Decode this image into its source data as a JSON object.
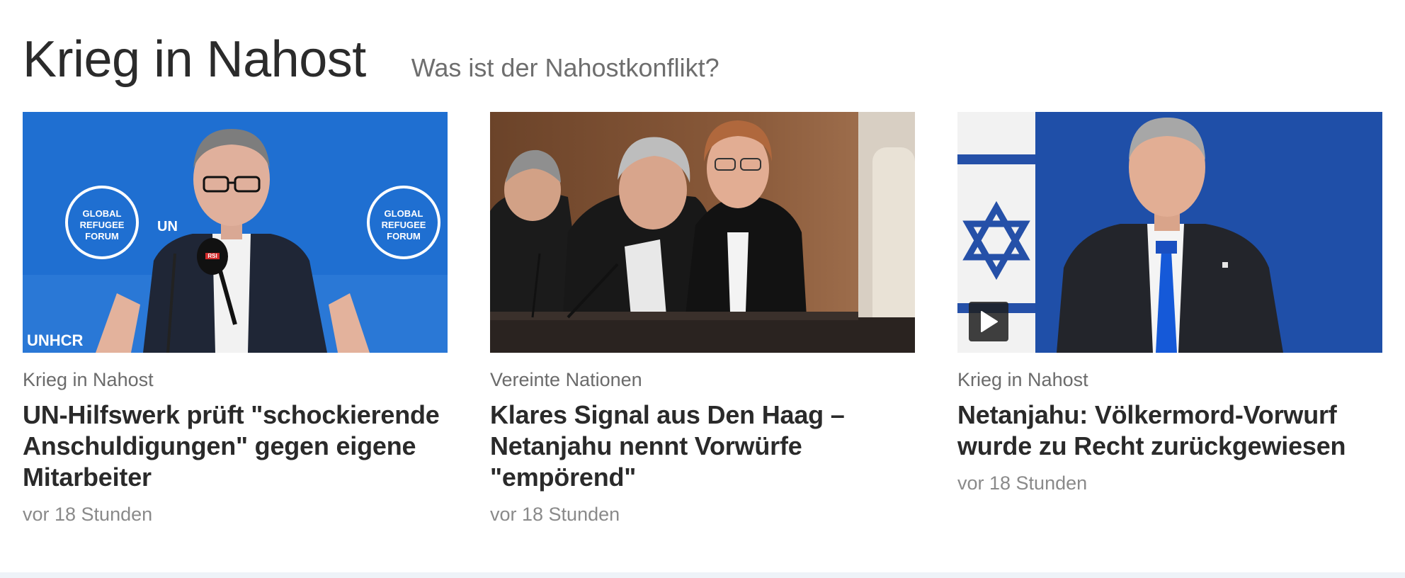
{
  "section": {
    "title": "Krieg in Nahost",
    "link": "Was ist der Nahostkonflikt?"
  },
  "cards": [
    {
      "topline": "Krieg in Nahost",
      "headline": "UN-Hilfswerk prüft \"schockierende Anschuldigungen\" gegen eigene Mitarbeiter",
      "date": "vor 18 Stunden",
      "image": {
        "backdrop_text_1": "GLOBAL",
        "backdrop_text_2": "REFUGEE",
        "backdrop_text_3": "FORUM",
        "backdrop_text_4": "UNHCR",
        "backdrop_text_5": "UN",
        "mic_label": "RSI"
      }
    },
    {
      "topline": "Vereinte Nationen",
      "headline": "Klares Signal aus Den Haag – Netanjahu nennt Vorwürfe \"empörend\"",
      "date": "vor 18 Stunden"
    },
    {
      "topline": "Krieg in Nahost",
      "headline": "Netanjahu: Völkermord-Vorwurf wurde zu Recht zurückgewiesen",
      "date": "vor 18 Stunden",
      "video": true
    }
  ],
  "colors": {
    "unhcr_blue": "#1f6fd1",
    "israel_blue": "#1f4fa8",
    "text_dark": "#2a2a2a",
    "text_muted": "#6b6b6b"
  },
  "icons": {
    "video": "play-icon"
  }
}
